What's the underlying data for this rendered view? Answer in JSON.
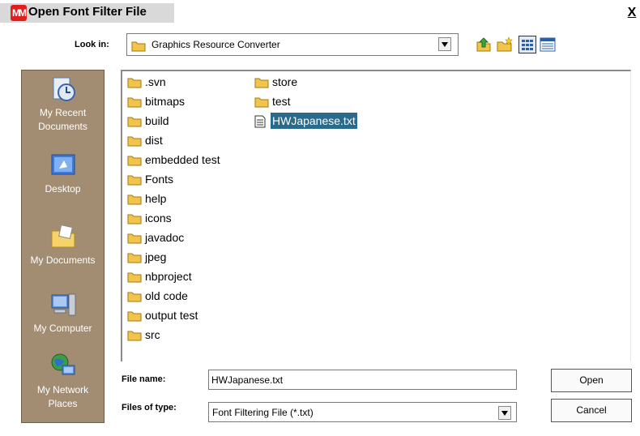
{
  "window": {
    "title": "Open Font Filter File",
    "close_symbol": "X"
  },
  "lookin": {
    "label": "Look in:",
    "value": "Graphics Resource Converter"
  },
  "toolbar": {
    "up_icon": "up-one-level-icon",
    "new_folder_icon": "new-folder-icon",
    "list_icon": "list-view-icon",
    "details_icon": "details-view-icon"
  },
  "places": [
    {
      "label": "My Recent Documents",
      "icon": "recent-documents-icon"
    },
    {
      "label": "Desktop",
      "icon": "desktop-icon"
    },
    {
      "label": "My Documents",
      "icon": "my-documents-icon"
    },
    {
      "label": "My Computer",
      "icon": "my-computer-icon"
    },
    {
      "label": "My Network Places",
      "icon": "network-places-icon"
    }
  ],
  "files": [
    {
      "name": ".svn",
      "type": "folder"
    },
    {
      "name": "bitmaps",
      "type": "folder"
    },
    {
      "name": "build",
      "type": "folder"
    },
    {
      "name": "dist",
      "type": "folder"
    },
    {
      "name": "embedded test",
      "type": "folder"
    },
    {
      "name": "Fonts",
      "type": "folder"
    },
    {
      "name": "help",
      "type": "folder"
    },
    {
      "name": "icons",
      "type": "folder"
    },
    {
      "name": "javadoc",
      "type": "folder"
    },
    {
      "name": "jpeg",
      "type": "folder"
    },
    {
      "name": "nbproject",
      "type": "folder"
    },
    {
      "name": "old code",
      "type": "folder"
    },
    {
      "name": "output test",
      "type": "folder"
    },
    {
      "name": "src",
      "type": "folder"
    },
    {
      "name": "store",
      "type": "folder"
    },
    {
      "name": "test",
      "type": "folder"
    },
    {
      "name": "HWJapanese.txt",
      "type": "text-file",
      "selected": true
    }
  ],
  "filename": {
    "label": "File name:",
    "value": "HWJapanese.txt"
  },
  "filetype": {
    "label": "Files of type:",
    "value": "Font Filtering File (*.txt)"
  },
  "buttons": {
    "open": "Open",
    "cancel": "Cancel"
  },
  "colors": {
    "places_bg": "#a38d72",
    "selection": "#2a6a8a",
    "folder": "#f2c44a"
  }
}
